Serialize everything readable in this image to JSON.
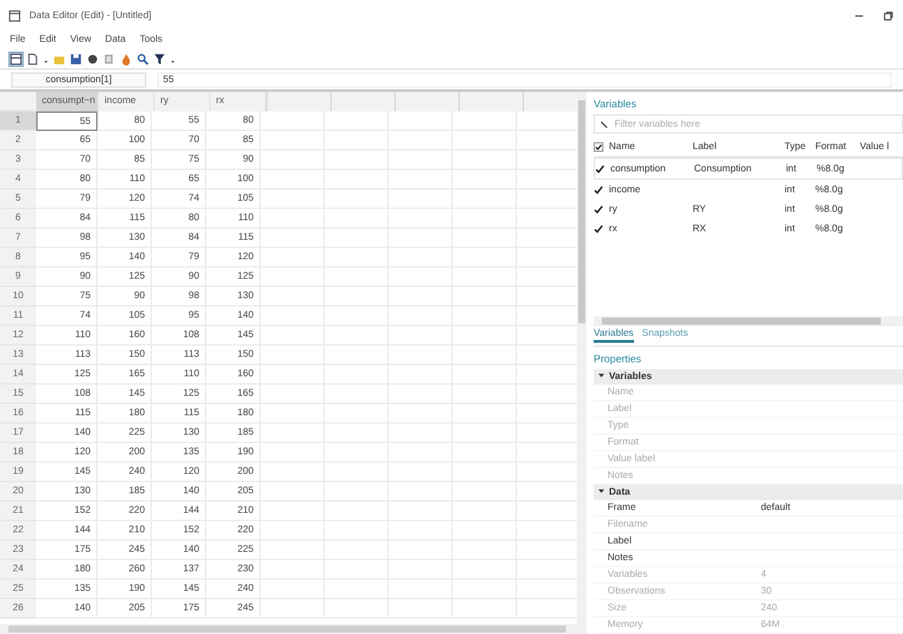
{
  "window": {
    "title": "Data Editor (Edit) - [Untitled]"
  },
  "menu": [
    "File",
    "Edit",
    "View",
    "Data",
    "Tools"
  ],
  "cell_bar": {
    "reference": "consumption[1]",
    "value": "55"
  },
  "grid": {
    "columns": [
      "consumpt~n",
      "income",
      "ry",
      "rx"
    ],
    "rows": [
      {
        "number": "1",
        "selected": true,
        "cells": [
          "55",
          "80",
          "55",
          "80"
        ]
      },
      {
        "number": "2",
        "selected": false,
        "cells": [
          "65",
          "100",
          "70",
          "85"
        ]
      },
      {
        "number": "3",
        "selected": false,
        "cells": [
          "70",
          "85",
          "75",
          "90"
        ]
      },
      {
        "number": "4",
        "selected": false,
        "cells": [
          "80",
          "110",
          "65",
          "100"
        ]
      },
      {
        "number": "5",
        "selected": false,
        "cells": [
          "79",
          "120",
          "74",
          "105"
        ]
      },
      {
        "number": "6",
        "selected": false,
        "cells": [
          "84",
          "115",
          "80",
          "110"
        ]
      },
      {
        "number": "7",
        "selected": false,
        "cells": [
          "98",
          "130",
          "84",
          "115"
        ]
      },
      {
        "number": "8",
        "selected": false,
        "cells": [
          "95",
          "140",
          "79",
          "120"
        ]
      },
      {
        "number": "9",
        "selected": false,
        "cells": [
          "90",
          "125",
          "90",
          "125"
        ]
      },
      {
        "number": "10",
        "selected": false,
        "cells": [
          "75",
          "90",
          "98",
          "130"
        ]
      },
      {
        "number": "11",
        "selected": false,
        "cells": [
          "74",
          "105",
          "95",
          "140"
        ]
      },
      {
        "number": "12",
        "selected": false,
        "cells": [
          "110",
          "160",
          "108",
          "145"
        ]
      },
      {
        "number": "13",
        "selected": false,
        "cells": [
          "113",
          "150",
          "113",
          "150"
        ]
      },
      {
        "number": "14",
        "selected": false,
        "cells": [
          "125",
          "165",
          "110",
          "160"
        ]
      },
      {
        "number": "15",
        "selected": false,
        "cells": [
          "108",
          "145",
          "125",
          "165"
        ]
      },
      {
        "number": "16",
        "selected": false,
        "cells": [
          "115",
          "180",
          "115",
          "180"
        ]
      },
      {
        "number": "17",
        "selected": false,
        "cells": [
          "140",
          "225",
          "130",
          "185"
        ]
      },
      {
        "number": "18",
        "selected": false,
        "cells": [
          "120",
          "200",
          "135",
          "190"
        ]
      },
      {
        "number": "19",
        "selected": false,
        "cells": [
          "145",
          "240",
          "120",
          "200"
        ]
      },
      {
        "number": "20",
        "selected": false,
        "cells": [
          "130",
          "185",
          "140",
          "205"
        ]
      },
      {
        "number": "21",
        "selected": false,
        "cells": [
          "152",
          "220",
          "144",
          "210"
        ]
      },
      {
        "number": "22",
        "selected": false,
        "cells": [
          "144",
          "210",
          "152",
          "220"
        ]
      },
      {
        "number": "23",
        "selected": false,
        "cells": [
          "175",
          "245",
          "140",
          "225"
        ]
      },
      {
        "number": "24",
        "selected": false,
        "cells": [
          "180",
          "260",
          "137",
          "230"
        ]
      },
      {
        "number": "25",
        "selected": false,
        "cells": [
          "135",
          "190",
          "145",
          "240"
        ]
      },
      {
        "number": "26",
        "selected": false,
        "cells": [
          "140",
          "205",
          "175",
          "245"
        ]
      }
    ]
  },
  "variables": {
    "title": "Variables",
    "filter": {
      "placeholder": "Filter variables here"
    },
    "columns": [
      "Name",
      "Label",
      "Type",
      "Format",
      "Value l"
    ],
    "all_checked": true,
    "rows": [
      {
        "checked": true,
        "name": "consumption",
        "label": "Consumption",
        "type": "int",
        "format": "%8.0g"
      },
      {
        "checked": true,
        "name": "income",
        "label": "",
        "type": "int",
        "format": "%8.0g"
      },
      {
        "checked": true,
        "name": "ry",
        "label": "RY",
        "type": "int",
        "format": "%8.0g"
      },
      {
        "checked": true,
        "name": "rx",
        "label": "RX",
        "type": "int",
        "format": "%8.0g"
      }
    ]
  },
  "tabs": [
    {
      "label": "Variables",
      "selected": true
    },
    {
      "label": "Snapshots",
      "selected": false
    }
  ],
  "properties": {
    "title": "Properties",
    "sections": [
      {
        "title": "Variables",
        "expanded": true,
        "rows": [
          {
            "label": "Name",
            "disabled": true
          },
          {
            "label": "Label",
            "disabled": true
          },
          {
            "label": "Type",
            "disabled": true
          },
          {
            "label": "Format",
            "disabled": true
          },
          {
            "label": "Value label",
            "disabled": true
          },
          {
            "label": "Notes",
            "disabled": true
          }
        ]
      },
      {
        "title": "Data",
        "expanded": true,
        "rows": [
          {
            "label": "Frame",
            "value": "default",
            "disabled": false
          },
          {
            "label": "Filename",
            "disabled": true
          },
          {
            "label": "Label",
            "disabled": false
          },
          {
            "label": "Notes",
            "disabled": false
          },
          {
            "label": "Variables",
            "value": "4",
            "disabled": true
          },
          {
            "label": "Observations",
            "value": "30",
            "disabled": true
          },
          {
            "label": "Size",
            "value": "240",
            "disabled": true
          },
          {
            "label": "Memory",
            "value": "64M",
            "disabled": true
          }
        ]
      }
    ]
  }
}
